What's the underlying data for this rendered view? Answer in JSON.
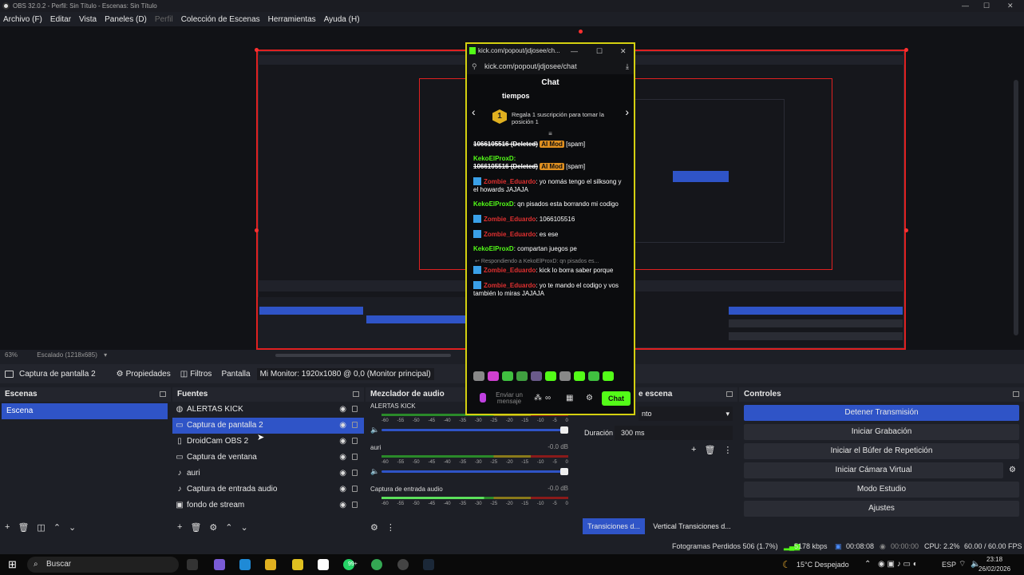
{
  "window": {
    "title": "OBS 32.0.2 - Perfil: Sin Título - Escenas: Sin Título",
    "minimize": "—",
    "maximize": "☐",
    "close": "✕"
  },
  "menu": [
    "Archivo (F)",
    "Editar",
    "Vista",
    "Paneles (D)",
    "Perfil",
    "Colección de Escenas",
    "Herramientas",
    "Ayuda (H)"
  ],
  "preview": {
    "zoom": "63%",
    "scale": "Escalado (1218x685)"
  },
  "source_toolbar": {
    "source": "Captura de pantalla 2",
    "properties": "Propiedades",
    "filters": "Filtros",
    "display_label": "Pantalla",
    "display_value": "Mi Monitor: 1920x1080 @ 0,0 (Monitor principal)"
  },
  "scenes": {
    "title": "Escenas",
    "items": [
      "Escena"
    ]
  },
  "sources": {
    "title": "Fuentes",
    "items": [
      {
        "name": "ALERTAS KICK",
        "icon": "globe-icon"
      },
      {
        "name": "Captura de pantalla 2",
        "icon": "monitor-icon"
      },
      {
        "name": "DroidCam OBS 2",
        "icon": "document-icon"
      },
      {
        "name": "Captura de ventana",
        "icon": "window-icon"
      },
      {
        "name": "auri",
        "icon": "microphone-icon"
      },
      {
        "name": "Captura de entrada audio",
        "icon": "microphone-icon"
      },
      {
        "name": "fondo de stream",
        "icon": "image-icon"
      }
    ]
  },
  "mixer": {
    "title": "Mezclador de audio",
    "ticks": [
      "-60",
      "-55",
      "-50",
      "-45",
      "-40",
      "-35",
      "-30",
      "-25",
      "-20",
      "-15",
      "-10",
      "-5",
      "0"
    ],
    "channels": [
      {
        "name": "ALERTAS KICK",
        "db": ""
      },
      {
        "name": "auri",
        "db": "-0.0 dB"
      },
      {
        "name": "Captura de entrada audio",
        "db": "-0.0 dB"
      }
    ]
  },
  "transitions": {
    "title": "Transiciones de escena",
    "title_visible": "e escena",
    "select": "nto",
    "duration_label": "Duración",
    "duration_value": "300 ms",
    "tab1": "Transiciones d...",
    "tab2": "Vertical Transiciones d..."
  },
  "controls": {
    "title": "Controles",
    "buttons": [
      "Detener Transmisión",
      "Iniciar Grabación",
      "Iniciar el Búfer de Repetición",
      "Iniciar Cámara Virtual",
      "Modo Estudio",
      "Ajustes"
    ]
  },
  "status": {
    "dropped": "Fotogramas Perdidos 506 (1.7%)",
    "bitrate": "5178 kbps",
    "stream_time": "00:08:08",
    "rec_time": "00:00:00",
    "cpu": "CPU: 2.2%",
    "fps": "60.00 / 60.00 FPS"
  },
  "taskbar": {
    "search": "Buscar",
    "weather": "15°C  Despejado",
    "lang": "ESP",
    "time": "23:18",
    "date": "26/02/2026",
    "badge": "99+"
  },
  "popup": {
    "title": "kick.com/popout/jdjosee/ch...",
    "url": "kick.com/popout/jdjosee/chat",
    "header": "Chat",
    "gift_title": "tiempos",
    "gift_rank": "1",
    "gift_text": "Regala 1 suscripción para tomar la posición 1",
    "messages": [
      {
        "user": "",
        "text": "1066105516 (Deleted)",
        "badge": "AI Mod",
        "tail": "[spam]",
        "type": "deleted"
      },
      {
        "user": "KekoElProxD:",
        "text": "1066105516 (Deleted)",
        "badge": "AI Mod",
        "tail": "[spam]",
        "type": "deleted-user"
      },
      {
        "user": "Zombie_Eduardo",
        "text": ": yo nomás tengo el silksong y el howards JAJAJA",
        "type": "red"
      },
      {
        "user": "KekoElProxD",
        "text": ": qn pisados esta borrando mi codigo",
        "type": "green"
      },
      {
        "user": "Zombie_Eduardo",
        "text": ": 1066105516",
        "type": "red"
      },
      {
        "user": "Zombie_Eduardo",
        "text": ": es ese",
        "type": "red"
      },
      {
        "user": "KekoElProxD",
        "text": ": compartan juegos pe",
        "type": "green"
      },
      {
        "user": "Zombie_Eduardo",
        "text": ": kick lo borra saber porque",
        "type": "red",
        "reply": "Respondiendo a KekoElProxD: qn pisados es..."
      },
      {
        "user": "Zombie_Eduardo",
        "text": ": yo te mando el codigo y vos también lo miras JAJAJA",
        "type": "red"
      }
    ],
    "input_placeholder": "Enviar un mensaje",
    "send": "Chat"
  },
  "colors": {
    "accent": "#2f54c7",
    "kick_green": "#53fc18",
    "preview_border": "#e02020"
  }
}
